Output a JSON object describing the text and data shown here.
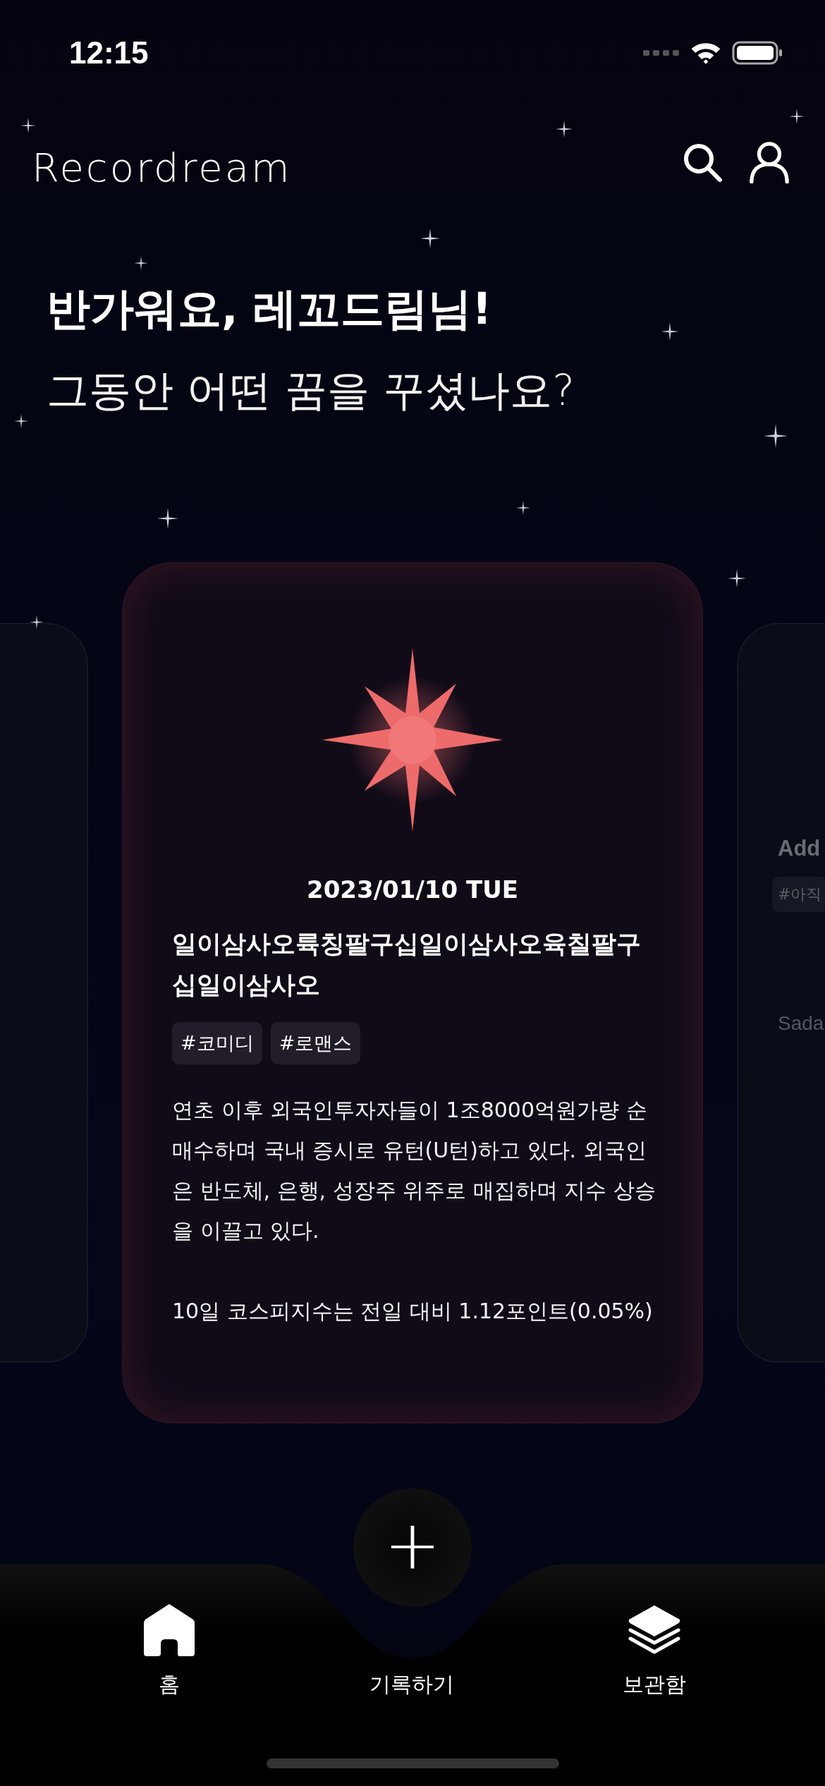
{
  "status_bar": {
    "time": "12:15"
  },
  "header": {
    "logo": "Recordream"
  },
  "greeting": {
    "title": "반가워요, 레꼬드림님!",
    "subtitle": "그동안 어떤 꿈을 꾸셨나요?"
  },
  "cards": [
    {
      "kind": "peek"
    },
    {
      "kind": "main",
      "date": "2023/01/10 TUE",
      "title": "일이삼사오륙칭팔구십일이삼사오육칠팔구십일이삼사오",
      "tags": [
        "#코미디",
        "#로맨스"
      ],
      "paragraphs": [
        "연초 이후 외국인투자자들이 1조8000억원가량 순매수하며 국내 증시로 유턴(U턴)하고 있다. 외국인은 반도체, 은행, 성장주 위주로 매집하며 지수 상승을 이끌고 있다.",
        "10일 코스피지수는 전일 대비 1.12포인트(0.05%)"
      ]
    },
    {
      "kind": "peek",
      "title": "Add",
      "tags": [
        "#아직"
      ],
      "body": "Sada"
    }
  ],
  "fab": {
    "label": "+"
  },
  "tabs": [
    {
      "label": "홈"
    },
    {
      "label": "기록하기"
    },
    {
      "label": "보관함"
    }
  ]
}
